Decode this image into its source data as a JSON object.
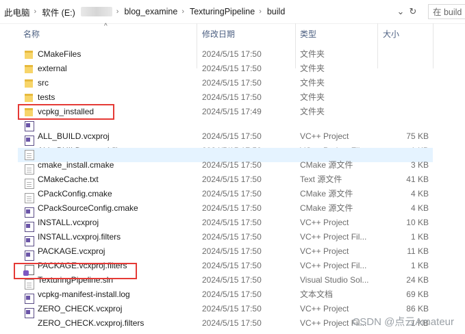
{
  "address": {
    "crumbs": [
      "此电脑",
      "软件 (E:)",
      "blog_examine",
      "TexturingPipeline",
      "build"
    ],
    "separator": "›",
    "dropdown_glyph": "⌄",
    "refresh_glyph": "↻",
    "search_placeholder": "在 build"
  },
  "columns": {
    "name": "名称",
    "date": "修改日期",
    "type": "类型",
    "size": "大小",
    "sort_glyph": "^"
  },
  "files": [
    {
      "name": "CMakeFiles",
      "date": "2024/5/15 17:50",
      "type": "文件夹",
      "size": "",
      "icon": "folder-icon"
    },
    {
      "name": "external",
      "date": "2024/5/15 17:50",
      "type": "文件夹",
      "size": "",
      "icon": "folder-icon"
    },
    {
      "name": "src",
      "date": "2024/5/15 17:50",
      "type": "文件夹",
      "size": "",
      "icon": "folder-icon"
    },
    {
      "name": "tests",
      "date": "2024/5/15 17:50",
      "type": "文件夹",
      "size": "",
      "icon": "folder-icon"
    },
    {
      "name": "vcpkg_installed",
      "date": "2024/5/15 17:49",
      "type": "文件夹",
      "size": "",
      "icon": "folder-icon"
    },
    {
      "name": "ALL_BUILD.vcxproj",
      "date": "2024/5/15 17:50",
      "type": "VC++ Project",
      "size": "75 KB",
      "icon": "vcxproj-icon"
    },
    {
      "name": "ALL_BUILD.vcxproj.filters",
      "date": "2024/5/15 17:50",
      "type": "VC++ Project Fil...",
      "size": "1 KB",
      "icon": "vcxproj-icon"
    },
    {
      "name": "cmake_install.cmake",
      "date": "2024/5/15 17:50",
      "type": "CMake 源文件",
      "size": "3 KB",
      "icon": "document-icon"
    },
    {
      "name": "CMakeCache.txt",
      "date": "2024/5/15 17:50",
      "type": "Text 源文件",
      "size": "41 KB",
      "icon": "document-icon"
    },
    {
      "name": "CPackConfig.cmake",
      "date": "2024/5/15 17:50",
      "type": "CMake 源文件",
      "size": "4 KB",
      "icon": "document-icon"
    },
    {
      "name": "CPackSourceConfig.cmake",
      "date": "2024/5/15 17:50",
      "type": "CMake 源文件",
      "size": "4 KB",
      "icon": "document-icon"
    },
    {
      "name": "INSTALL.vcxproj",
      "date": "2024/5/15 17:50",
      "type": "VC++ Project",
      "size": "10 KB",
      "icon": "vcxproj-icon"
    },
    {
      "name": "INSTALL.vcxproj.filters",
      "date": "2024/5/15 17:50",
      "type": "VC++ Project Fil...",
      "size": "1 KB",
      "icon": "vcxproj-icon"
    },
    {
      "name": "PACKAGE.vcxproj",
      "date": "2024/5/15 17:50",
      "type": "VC++ Project",
      "size": "11 KB",
      "icon": "vcxproj-icon"
    },
    {
      "name": "PACKAGE.vcxproj.filters",
      "date": "2024/5/15 17:50",
      "type": "VC++ Project Fil...",
      "size": "1 KB",
      "icon": "vcxproj-icon"
    },
    {
      "name": "TexturingPipeline.sln",
      "date": "2024/5/15 17:50",
      "type": "Visual Studio Sol...",
      "size": "24 KB",
      "icon": "solution-icon"
    },
    {
      "name": "vcpkg-manifest-install.log",
      "date": "2024/5/15 17:50",
      "type": "文本文档",
      "size": "69 KB",
      "icon": "document-icon"
    },
    {
      "name": "ZERO_CHECK.vcxproj",
      "date": "2024/5/15 17:50",
      "type": "VC++ Project",
      "size": "86 KB",
      "icon": "vcxproj-icon"
    },
    {
      "name": "ZERO_CHECK.vcxproj.filters",
      "date": "2024/5/15 17:50",
      "type": "VC++ Project Fil...",
      "size": "1 KB",
      "icon": "vcxproj-icon"
    }
  ],
  "selected_index": 7,
  "highlighted_indices": [
    4,
    15
  ],
  "watermark": "CSDN @点云Amateur",
  "colors": {
    "highlight_box": "#e53935",
    "selection": "#e5f3ff",
    "header_text": "#4d6082"
  }
}
